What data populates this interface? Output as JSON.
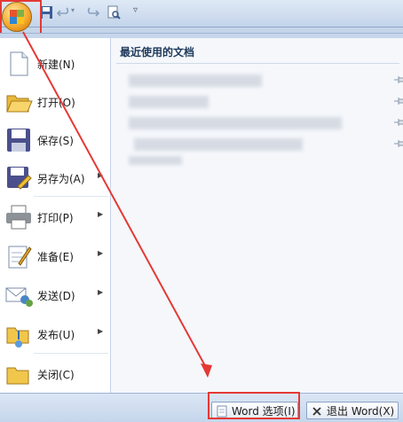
{
  "menu_items": [
    {
      "label": "新建(N)",
      "submenu": false
    },
    {
      "label": "打开(O)",
      "submenu": false
    },
    {
      "label": "保存(S)",
      "submenu": false
    },
    {
      "label": "另存为(A)",
      "submenu": true
    },
    {
      "label": "打印(P)",
      "submenu": true
    },
    {
      "label": "准备(E)",
      "submenu": true
    },
    {
      "label": "发送(D)",
      "submenu": true
    },
    {
      "label": "发布(U)",
      "submenu": true
    },
    {
      "label": "关闭(C)",
      "submenu": false
    }
  ],
  "recent": {
    "title": "最近使用的文档"
  },
  "footer": {
    "options_label": "Word 选项(I)",
    "exit_label": "退出 Word(X)"
  },
  "colors": {
    "highlight": "#e53935",
    "accent": "#1e395b"
  }
}
